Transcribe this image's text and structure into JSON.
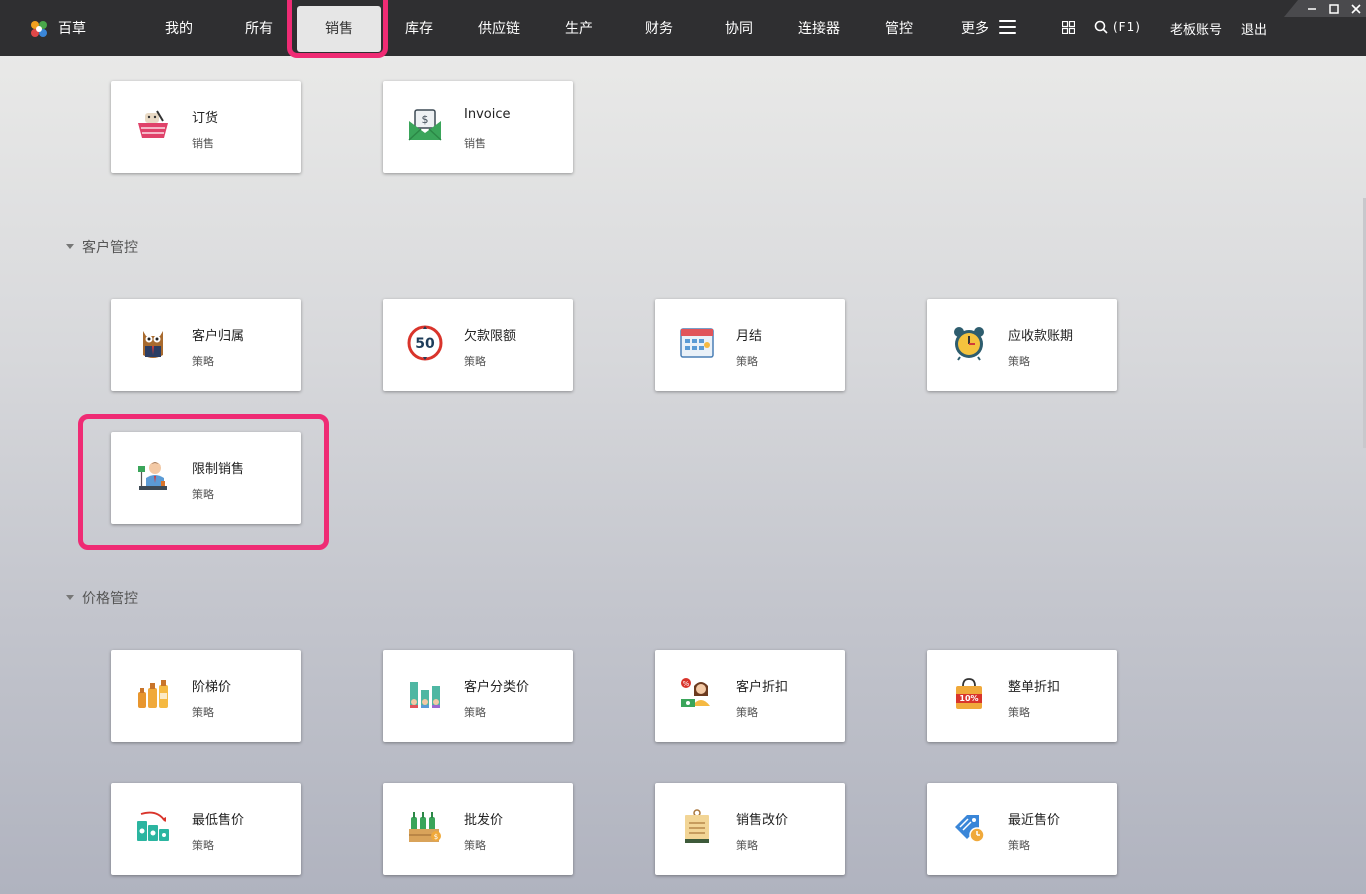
{
  "brand": "百草",
  "nav": [
    "我的",
    "所有",
    "销售",
    "库存",
    "供应链",
    "生产",
    "财务",
    "协同",
    "连接器",
    "管控",
    "更多"
  ],
  "active_nav": "销售",
  "search_shortcut": "(F1)",
  "account": "老板账号",
  "logout": "退出",
  "top_cards": [
    {
      "title": "订货",
      "sub": "销售",
      "icon": "shopping-basket-icon"
    },
    {
      "title": "Invoice",
      "sub": "销售",
      "icon": "invoice-envelope-icon"
    }
  ],
  "sections": [
    {
      "title": "客户管控",
      "cards": [
        {
          "title": "客户归属",
          "sub": "策略",
          "icon": "owl-manager-icon"
        },
        {
          "title": "欠款限额",
          "sub": "策略",
          "icon": "limit-50-sign-icon"
        },
        {
          "title": "月结",
          "sub": "策略",
          "icon": "calendar-icon"
        },
        {
          "title": "应收款账期",
          "sub": "策略",
          "icon": "alarm-clock-icon"
        },
        {
          "title": "限制销售",
          "sub": "策略",
          "icon": "salesman-icon"
        }
      ]
    },
    {
      "title": "价格管控",
      "cards": [
        {
          "title": "阶梯价",
          "sub": "策略",
          "icon": "bottles-icon"
        },
        {
          "title": "客户分类价",
          "sub": "策略",
          "icon": "customer-groups-icon"
        },
        {
          "title": "客户折扣",
          "sub": "策略",
          "icon": "customer-discount-icon"
        },
        {
          "title": "整单折扣",
          "sub": "策略",
          "icon": "discount-bag-icon"
        },
        {
          "title": "最低售价",
          "sub": "策略",
          "icon": "lowest-price-icon"
        },
        {
          "title": "批发价",
          "sub": "策略",
          "icon": "wholesale-crate-icon"
        },
        {
          "title": "销售改价",
          "sub": "策略",
          "icon": "price-tag-icon"
        },
        {
          "title": "最近售价",
          "sub": "策略",
          "icon": "recent-price-icon"
        }
      ]
    }
  ]
}
